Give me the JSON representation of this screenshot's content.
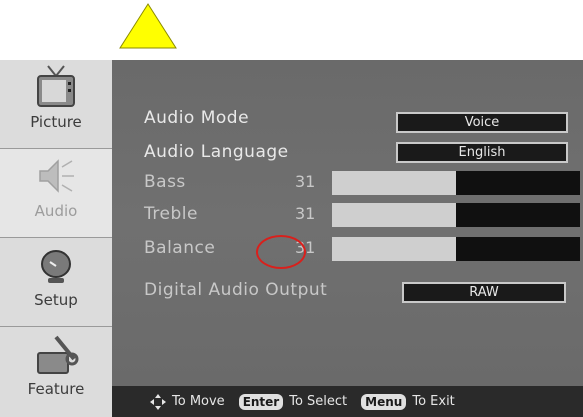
{
  "sidebar": {
    "items": [
      {
        "label": "Picture",
        "icon": "tv-icon",
        "active": true
      },
      {
        "label": "Audio",
        "icon": "speaker-icon",
        "active": false
      },
      {
        "label": "Setup",
        "icon": "satellite-dish-icon",
        "active": true
      },
      {
        "label": "Feature",
        "icon": "tools-icon",
        "active": true
      }
    ]
  },
  "menu": {
    "rows": [
      {
        "label": "Audio Mode",
        "value": "Voice"
      },
      {
        "label": "Audio Language",
        "value": "English"
      },
      {
        "label": "Bass",
        "number": "31",
        "level": 0.5
      },
      {
        "label": "Treble",
        "number": "31",
        "level": 0.5
      },
      {
        "label": "Balance",
        "number": "31",
        "level": 0.5
      },
      {
        "label": "Digital Audio Output",
        "value": "RAW"
      }
    ]
  },
  "footer": {
    "move": "To Move",
    "enter_key": "Enter",
    "select": "To Select",
    "menu_key": "Menu",
    "exit": "To Exit"
  },
  "colors": {
    "triangle": "#ffff00",
    "panel": "#6c6c6c",
    "highlight_circle": "#d9201c"
  }
}
